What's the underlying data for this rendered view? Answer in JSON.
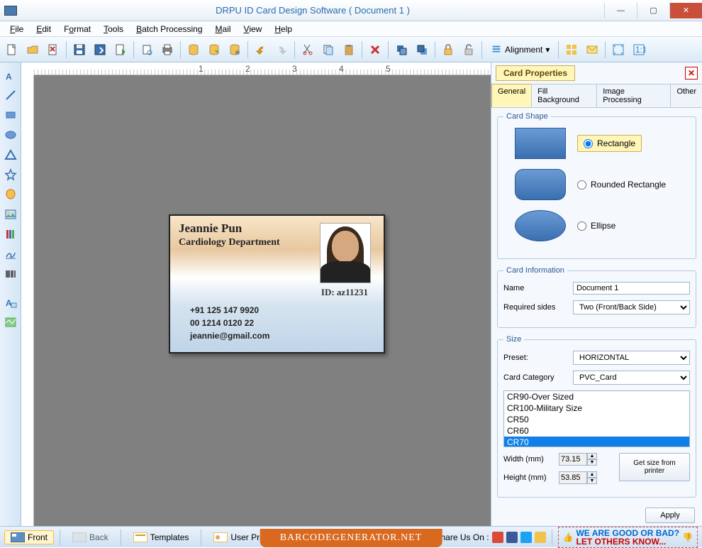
{
  "window": {
    "title": "DRPU ID Card Design Software ( Document 1 )"
  },
  "menu": {
    "items": [
      "File",
      "Edit",
      "Format",
      "Tools",
      "Batch Processing",
      "Mail",
      "View",
      "Help"
    ]
  },
  "toolbar": {
    "alignment_label": "Alignment"
  },
  "card": {
    "name": "Jeannie Pun",
    "dept": "Cardiology Department",
    "id_label": "ID: az11231",
    "phone1": "+91 125 147 9920",
    "phone2": "00 1214 0120 22",
    "email": "jeannie@gmail.com"
  },
  "props": {
    "title": "Card Properties",
    "tabs": [
      "General",
      "Fill Background",
      "Image Processing",
      "Other"
    ],
    "shape_legend": "Card Shape",
    "shapes": {
      "rect": "Rectangle",
      "rounded": "Rounded Rectangle",
      "ellipse": "Ellipse"
    },
    "info_legend": "Card Information",
    "name_label": "Name",
    "name_value": "Document 1",
    "sides_label": "Required sides",
    "sides_value": "Two (Front/Back Side)",
    "size_legend": "Size",
    "preset_label": "Preset:",
    "preset_value": "HORIZONTAL",
    "category_label": "Card Category",
    "category_value": "PVC_Card",
    "list": [
      "CR90-Over Sized",
      "CR100-Military Size",
      "CR50",
      "CR60",
      "CR70"
    ],
    "list_selected": "CR70",
    "width_label": "Width  (mm)",
    "width_value": "73.15",
    "height_label": "Height (mm)",
    "height_value": "53.85",
    "printer_btn": "Get size from printer",
    "apply_btn": "Apply"
  },
  "bottom": {
    "front": "Front",
    "back": "Back",
    "templates": "Templates",
    "profile": "User Profile",
    "share_label": "Share Us On :",
    "feedback1": "WE ARE GOOD OR BAD?",
    "feedback2": "LET OTHERS KNOW..."
  },
  "footer": "BARCODEGENERATOR.NET"
}
